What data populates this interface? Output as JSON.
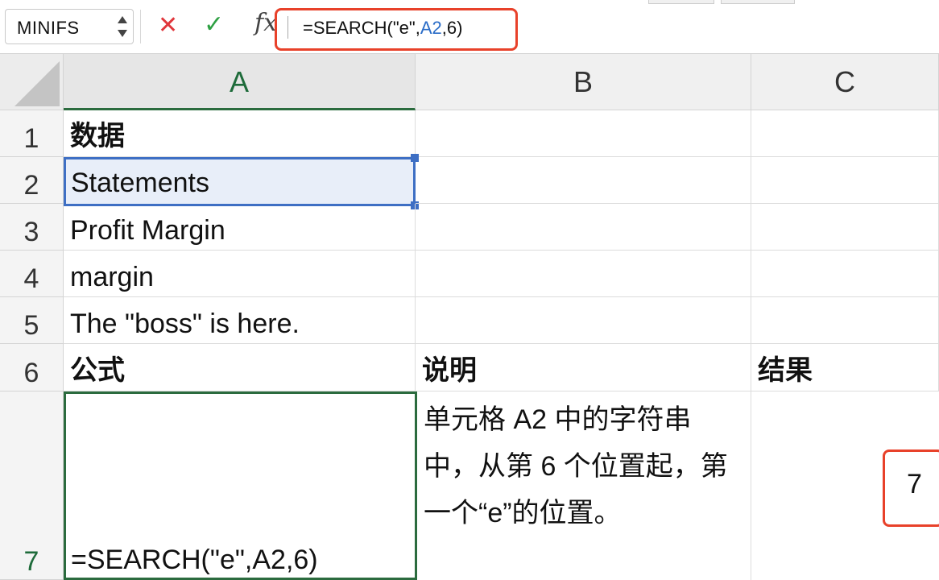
{
  "name_box": {
    "value": "MINIFS"
  },
  "formula_bar": {
    "prefix": "=SEARCH(\"e\",",
    "ref": "A2",
    "suffix": ",6)"
  },
  "columns": [
    "A",
    "B",
    "C"
  ],
  "rows": [
    "1",
    "2",
    "3",
    "4",
    "5",
    "6",
    "7"
  ],
  "cells": {
    "A1": "数据",
    "A2": "Statements",
    "A3": "Profit Margin",
    "A4": "margin",
    "A5": "The \"boss\" is here.",
    "A6": "公式",
    "B6": "说明",
    "C6": "结果",
    "A7": "=SEARCH(\"e\",A2,6)",
    "B7": "单元格 A2 中的字符串中，从第 6 个位置起，第一个“e”的位置。",
    "C7": "7"
  },
  "colors": {
    "highlight": "#e8412a",
    "selection": "#3e6fc4",
    "active_cell": "#2b6b3e",
    "cancel": "#e0363b",
    "enter": "#2ea043"
  }
}
